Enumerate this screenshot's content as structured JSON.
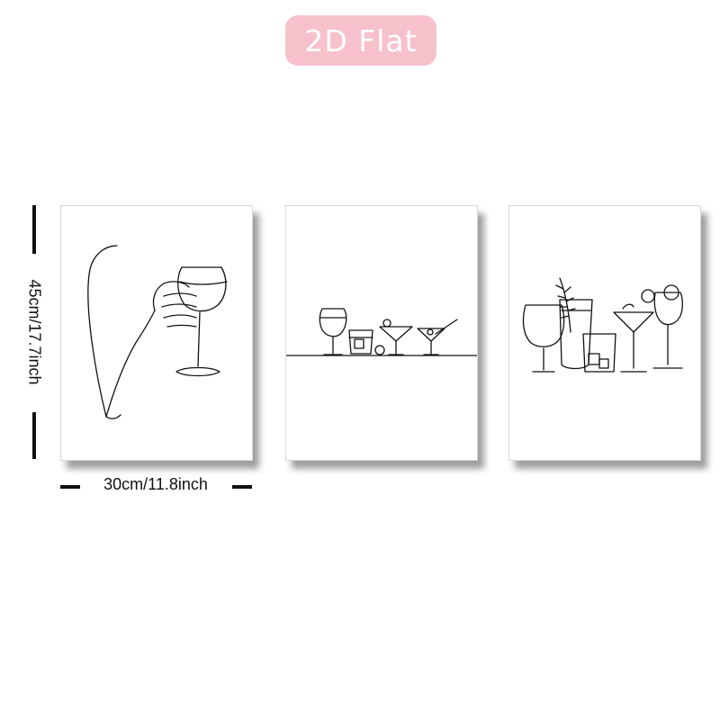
{
  "badge": {
    "label": "2D Flat",
    "background": "#f7c1cc",
    "text_color": "#ffffff"
  },
  "dimensions": {
    "width_label": "30cm/11.8inch",
    "height_label": "45cm/17.7inch"
  },
  "prints": [
    {
      "subject": "hand-holding-wine-glass-line-art"
    },
    {
      "subject": "row-of-cocktail-glasses-line-art"
    },
    {
      "subject": "cocktail-glasses-cluster-line-art"
    }
  ]
}
